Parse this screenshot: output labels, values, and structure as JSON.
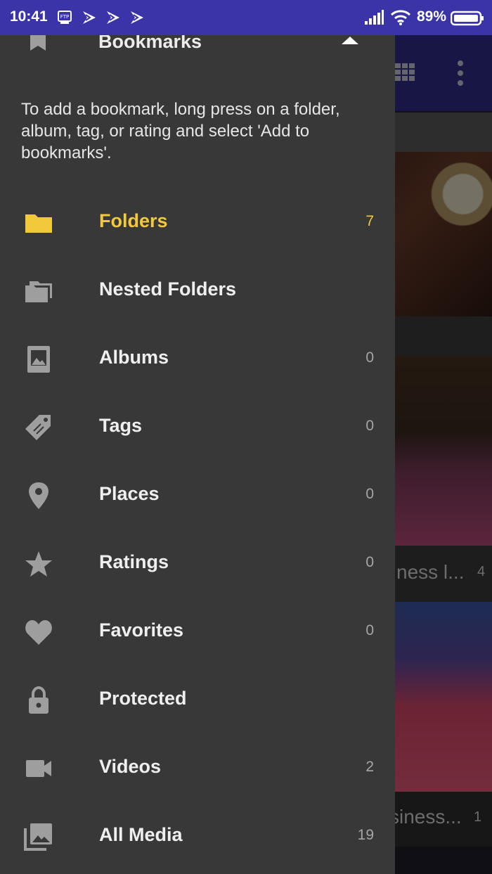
{
  "status_bar": {
    "time": "10:41",
    "battery": "89%",
    "icons": [
      "ftp-icon",
      "app-notification-icon",
      "app-notification-icon",
      "app-notification-icon",
      "signal-icon",
      "wifi-icon",
      "battery-icon"
    ]
  },
  "background": {
    "snippet1": "ness l...",
    "snippet1_count": "4",
    "snippet2": "siness...",
    "snippet2_count": "1"
  },
  "drawer": {
    "bookmarks_title": "Bookmarks",
    "hint": "To add a bookmark, long press on a folder, album, tag, or rating and select 'Add to bookmarks'.",
    "items": [
      {
        "label": "Folders",
        "count": "7",
        "icon": "folder-icon",
        "active": true
      },
      {
        "label": "Nested Folders",
        "count": "",
        "icon": "nested-folders-icon"
      },
      {
        "label": "Albums",
        "count": "0",
        "icon": "album-icon"
      },
      {
        "label": "Tags",
        "count": "0",
        "icon": "tag-icon"
      },
      {
        "label": "Places",
        "count": "0",
        "icon": "place-pin-icon"
      },
      {
        "label": "Ratings",
        "count": "0",
        "icon": "star-icon"
      },
      {
        "label": "Favorites",
        "count": "0",
        "icon": "heart-icon"
      },
      {
        "label": "Protected",
        "count": "",
        "icon": "lock-icon"
      },
      {
        "label": "Videos",
        "count": "2",
        "icon": "video-camera-icon"
      },
      {
        "label": "All Media",
        "count": "19",
        "icon": "all-media-icon"
      }
    ]
  },
  "colors": {
    "status_bar": "#3a34a8",
    "drawer_bg": "#383838",
    "accent": "#f3c93c",
    "icon_gray": "#9e9e9e"
  }
}
